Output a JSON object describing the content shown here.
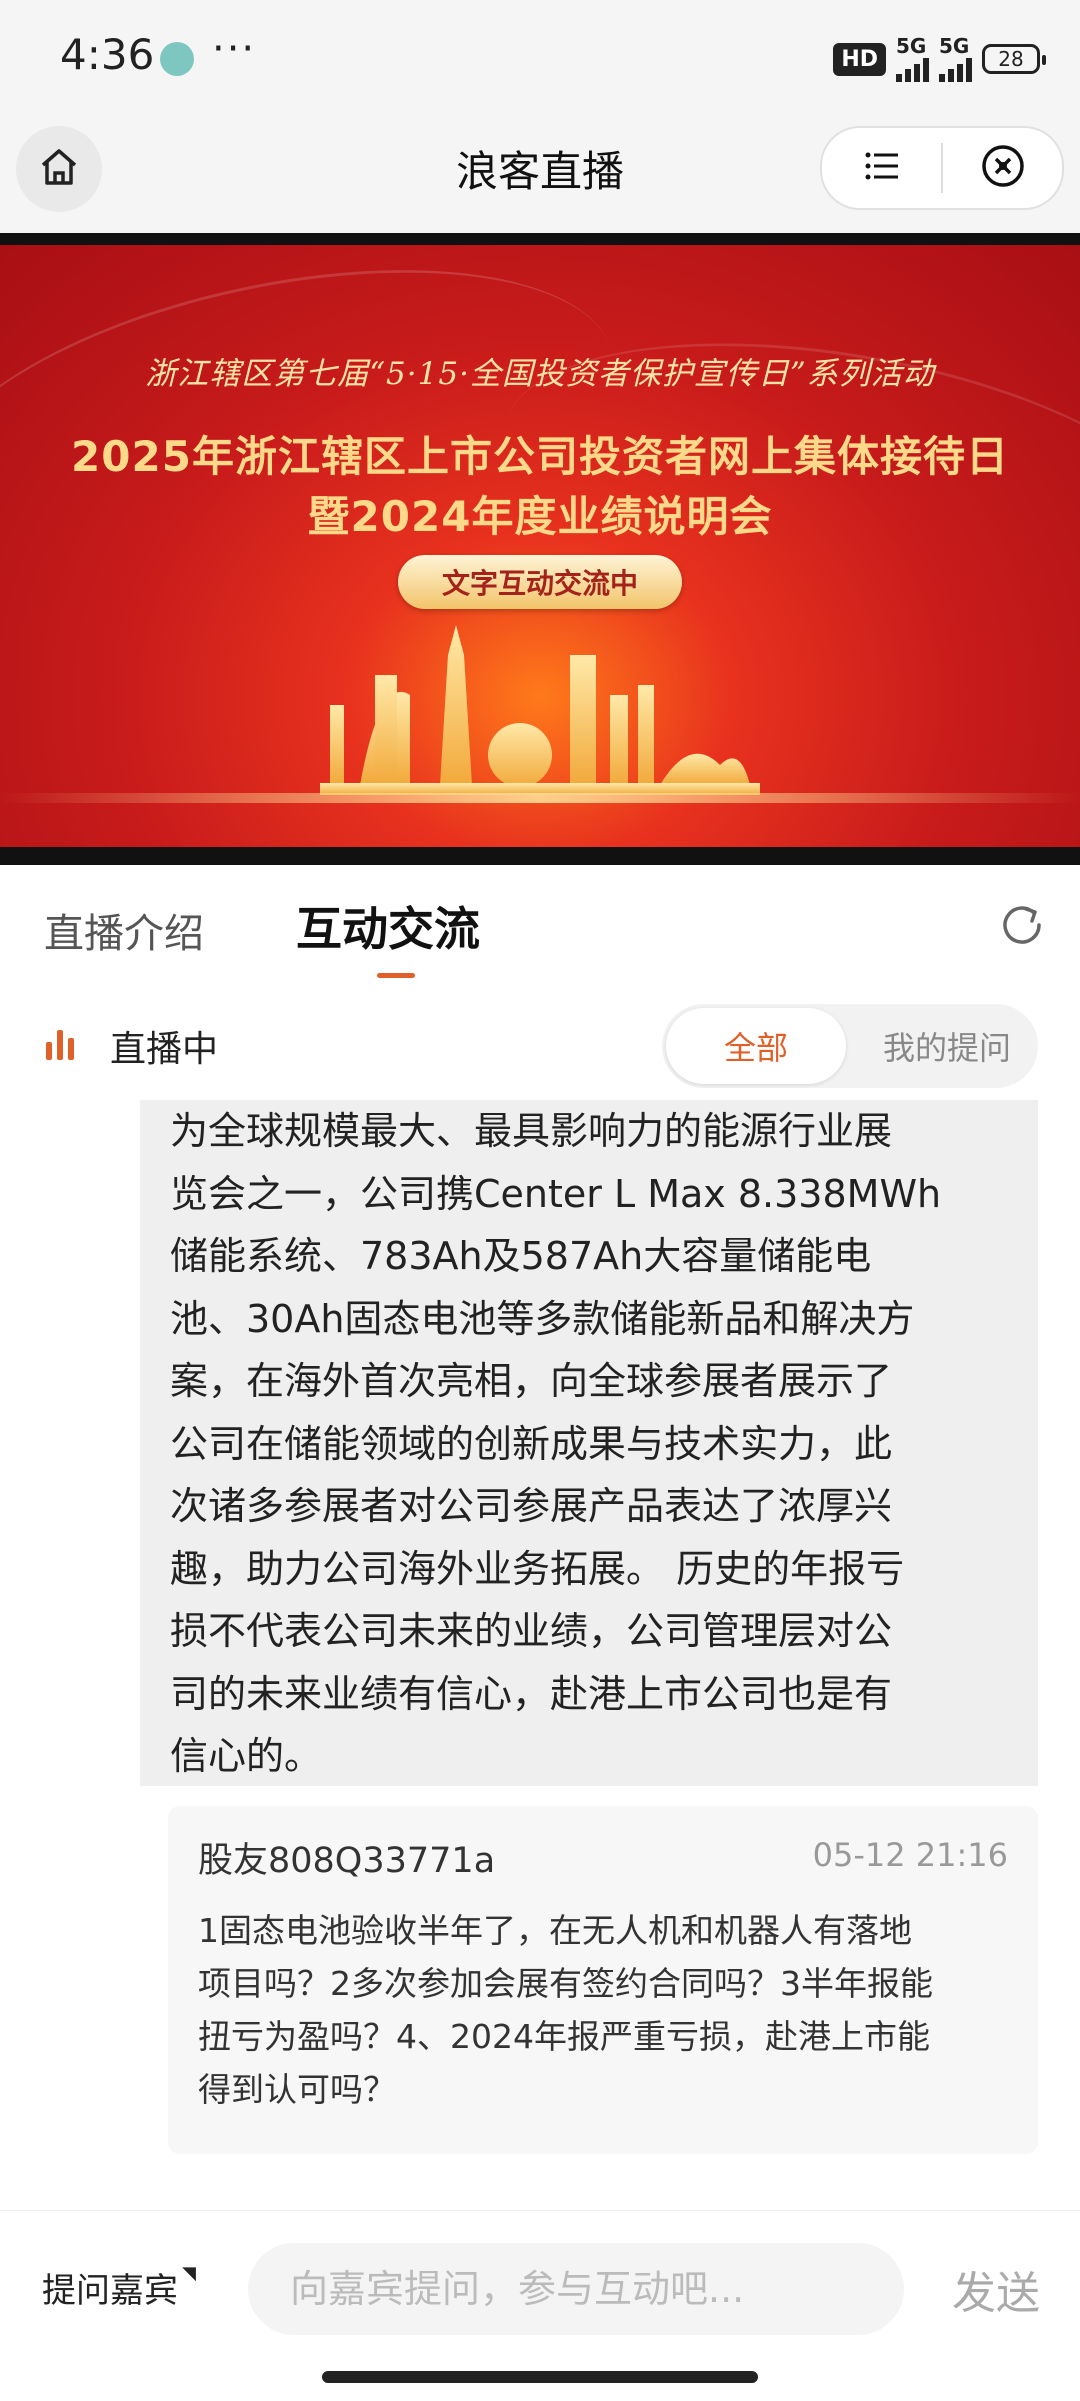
{
  "status_bar": {
    "time": "4:36",
    "more": "···",
    "hd": "HD",
    "net1": "5G",
    "net2": "5G",
    "battery": "28"
  },
  "header": {
    "title": "浪客直播"
  },
  "banner": {
    "subtitle": "浙江辖区第七届“5·15·全国投资者保护宣传日”系列活动",
    "title_line1": "2025年浙江辖区上市公司投资者网上集体接待日",
    "title_line2": "暨2024年度业绩说明会",
    "pill": "文字互动交流中"
  },
  "tabs": [
    {
      "label": "直播介绍"
    },
    {
      "label": "互动交流"
    }
  ],
  "live": {
    "label": "直播中",
    "filter_all": "全部",
    "filter_mine": "我的提问"
  },
  "answer": {
    "lines": [
      "为全球规模最大、最具影响力的能源行业展",
      "览会之一，公司携Center L Max 8.338MWh",
      "储能系统、783Ah及587Ah大容量储能电",
      "池、30Ah固态电池等多款储能新品和解决方",
      "案，在海外首次亮相，向全球参展者展示了",
      "公司在储能领域的创新成果与技术实力，此",
      "次诸多参展者对公司参展产品表达了浓厚兴",
      "趣，助力公司海外业务拓展。 历史的年报亏",
      "损不代表公司未来的业绩，公司管理层对公",
      "司的未来业绩有信心，赴港上市公司也是有",
      "信心的。"
    ]
  },
  "question": {
    "user": "股友808Q33771a",
    "time": "05-12 21:16",
    "lines": [
      "1固态电池验收半年了，在无人机和机器人有落地",
      "项目吗？2多次参加会展有签约合同吗？3半年报能",
      "扭亏为盈吗？4、2024年报严重亏损，赴港上市能",
      "得到认可吗？"
    ]
  },
  "bottom": {
    "ask_guest": "提问嘉宾",
    "input_placeholder": "向嘉宾提问，参与互动吧...",
    "send": "发送"
  },
  "colors": {
    "accent": "#e0602a",
    "banner_red": "#c81b1b",
    "banner_gold": "#ffd98a"
  },
  "icons": [
    "home-icon",
    "menu-icon",
    "close-icon",
    "refresh-icon",
    "live-bars-icon"
  ]
}
